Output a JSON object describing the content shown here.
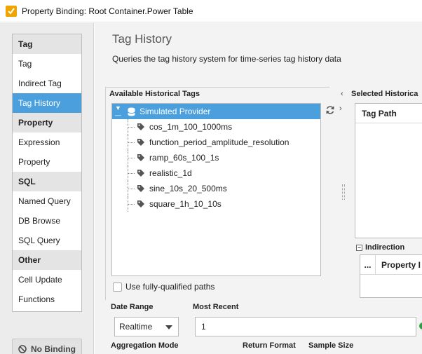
{
  "window": {
    "title": "Property Binding: Root Container.Power Table"
  },
  "sidebar": {
    "items": [
      {
        "label": "Tag",
        "type": "header"
      },
      {
        "label": "Tag",
        "type": "item"
      },
      {
        "label": "Indirect Tag",
        "type": "item"
      },
      {
        "label": "Tag History",
        "type": "item",
        "selected": true
      },
      {
        "label": "Property",
        "type": "header"
      },
      {
        "label": "Expression",
        "type": "item"
      },
      {
        "label": "Property",
        "type": "item"
      },
      {
        "label": "SQL",
        "type": "header"
      },
      {
        "label": "Named Query",
        "type": "item"
      },
      {
        "label": "DB Browse",
        "type": "item"
      },
      {
        "label": "SQL Query",
        "type": "item"
      },
      {
        "label": "Other",
        "type": "header"
      },
      {
        "label": "Cell Update",
        "type": "item"
      },
      {
        "label": "Functions",
        "type": "item"
      }
    ],
    "no_binding_label": "No Binding"
  },
  "main": {
    "title": "Tag History",
    "description": "Queries the tag history system for time-series tag history data",
    "available": {
      "label": "Available Historical Tags",
      "root": "Simulated Provider",
      "tags": [
        "cos_1m_100_1000ms",
        "function_period_amplitude_resolution",
        "ramp_60s_100_1s",
        "realistic_1d",
        "sine_10s_20_500ms",
        "square_1h_10_10s"
      ]
    },
    "selected": {
      "label": "Selected Historica",
      "column_header": "Tag Path"
    },
    "indirection": {
      "label": "Indirection",
      "col_dots": "...",
      "col_property": "Property I"
    },
    "fully_qualified_label": "Use fully-qualified paths",
    "date_range": {
      "label": "Date Range",
      "value": "Realtime"
    },
    "most_recent": {
      "label": "Most Recent",
      "value": "1"
    },
    "aggregation_mode_label": "Aggregation Mode",
    "return_format_label": "Return Format",
    "sample_size_label": "Sample Size"
  },
  "colors": {
    "selection": "#4a9fdc",
    "app_icon": "#f0a400",
    "status_ok": "#2ea043"
  }
}
